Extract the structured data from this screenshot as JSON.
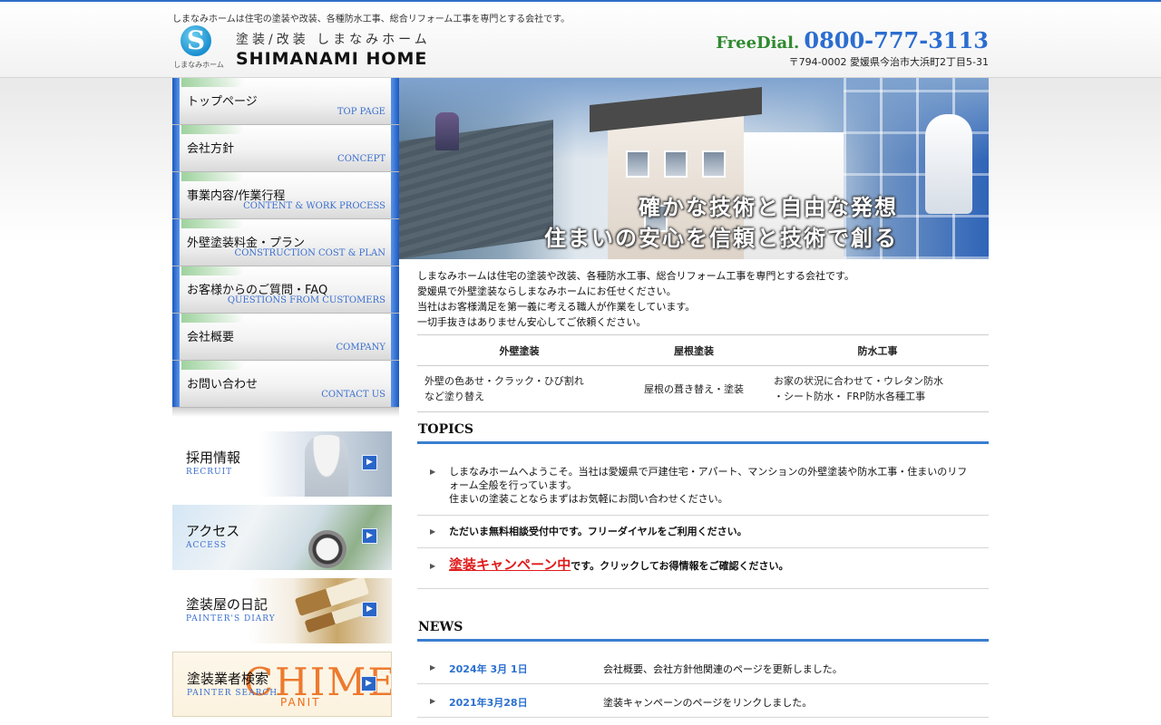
{
  "header": {
    "tagline": "しまなみホームは住宅の塗装や改装、各種防水工事、総合リフォーム工事を専門とする会社です。",
    "logo_letter": "S",
    "logo_name": "しまなみホーム",
    "brand_sub": "塗装/改装 しまなみホーム",
    "brand_main": "SHIMANAMI HOME",
    "freedial_label": "FreeDial.",
    "freedial_number": "0800-777-3113",
    "address": "〒794-0002 愛媛県今治市大浜町2丁目5-31"
  },
  "nav": {
    "items": [
      {
        "jp": "トップページ",
        "en": "TOP PAGE"
      },
      {
        "jp": "会社方針",
        "en": "CONCEPT"
      },
      {
        "jp": "事業内容/作業行程",
        "en": "CONTENT & WORK PROCESS"
      },
      {
        "jp": "外壁塗装料金・プラン",
        "en": "CONSTRUCTION COST & PLAN"
      },
      {
        "jp": "お客様からのご質問・FAQ",
        "en": "QUESTIONS FROM CUSTOMERS"
      },
      {
        "jp": "会社概要",
        "en": "COMPANY"
      },
      {
        "jp": "お問い合わせ",
        "en": "CONTACT US"
      }
    ]
  },
  "banners": {
    "recruit": {
      "jp": "採用情報",
      "en": "RECRUIT"
    },
    "access": {
      "jp": "アクセス",
      "en": "ACCESS"
    },
    "diary": {
      "jp": "塗装屋の日記",
      "en": "PAINTER'S DIARY"
    },
    "search": {
      "jp": "塗装業者検索",
      "en": "PAINTER SEARCH",
      "logo": "CHIME",
      "logo_sub": "PANIT"
    },
    "arrow_glyph": "▶"
  },
  "hero": {
    "line1": "確かな技術と自由な発想",
    "line2": "住まいの安心を信頼と技術で創る"
  },
  "intro": {
    "line1": "しまなみホームは住宅の塗装や改装、各種防水工事、総合リフォーム工事を専門とする会社です。",
    "line2": "愛媛県で外壁塗装ならしまなみホームにお任せください。",
    "line3": "当社はお客様満足を第一義に考える職人が作業をしています。",
    "line4": "一切手抜きはありません安心してご依頼ください。"
  },
  "services": {
    "headers": [
      "外壁塗装",
      "屋根塗装",
      "防水工事"
    ],
    "cells": [
      [
        "外壁の色あせ・クラック・ひび割れ",
        "など塗り替え"
      ],
      [
        "屋根の葺き替え・塗装"
      ],
      [
        "お家の状況に合わせて・ウレタン防水",
        "・シート防水・ FRP防水各種工事"
      ]
    ]
  },
  "topics": {
    "title": "TOPICS",
    "arrow_glyph": "▶",
    "item1_line1": "しまなみホームへようこそ。当社は愛媛県で戸建住宅・アパート、マンションの外壁塗装や防水工事・住まいのリフ",
    "item1_line2": "ォーム全般を行っています。",
    "item1_line3": "住まいの塗装ことならまずはお気軽にお問い合わせください。",
    "item2": "ただいま無料相談受付中です。フリーダイヤルをご利用ください。",
    "item3_link": "塗装キャンペーン中",
    "item3_rest": "です。クリックしてお得情報をご確認ください。"
  },
  "news": {
    "title": "NEWS",
    "items": [
      {
        "date": "2024年 3月 1日",
        "text": "会社概要、会社方針他関連のページを更新しました。"
      },
      {
        "date": "2021年3月28日",
        "text": "塗装キャンペーンのページをリンクしました。"
      }
    ]
  },
  "colors": {
    "accent_blue": "#2f6fc8",
    "freedial_green": "#2f8a2f",
    "campaign_red": "#e01a1a"
  }
}
